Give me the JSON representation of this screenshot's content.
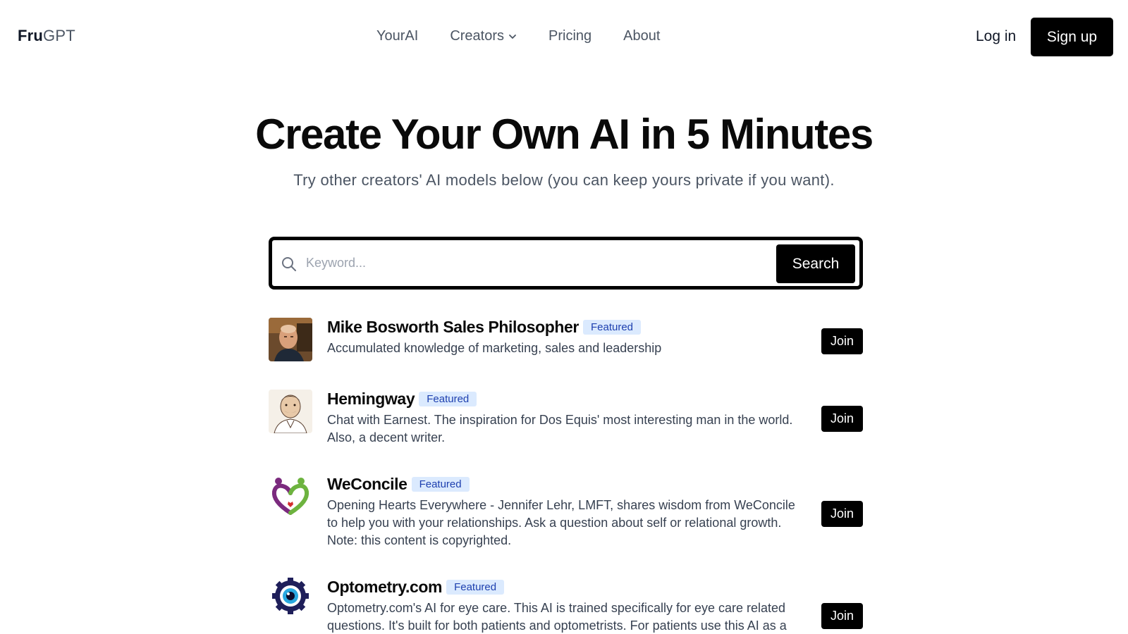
{
  "header": {
    "logo_bold": "Fru",
    "logo_rest": "GPT",
    "nav": [
      {
        "label": "YourAI"
      },
      {
        "label": "Creators"
      },
      {
        "label": "Pricing"
      },
      {
        "label": "About"
      }
    ],
    "login": "Log in",
    "signup": "Sign up"
  },
  "hero": {
    "title": "Create Your Own AI in 5 Minutes",
    "subtitle": "Try other creators' AI models below (you can keep yours private if you want)."
  },
  "search": {
    "placeholder": "Keyword...",
    "button": "Search"
  },
  "listings": [
    {
      "name": "Mike Bosworth Sales Philosopher",
      "badge": "Featured",
      "description": "Accumulated knowledge of marketing, sales and leadership",
      "join": "Join",
      "icon": "portrait-photo-icon"
    },
    {
      "name": "Hemingway",
      "badge": "Featured",
      "description": "Chat with Earnest. The inspiration for Dos Equis' most interesting man in the world. Also, a decent writer.",
      "join": "Join",
      "icon": "portrait-sketch-icon"
    },
    {
      "name": "WeConcile",
      "badge": "Featured",
      "description": "Opening Hearts Everywhere - Jennifer Lehr, LMFT, shares wisdom from WeConcile to help you with your relationships. Ask a question about self or relational growth. Note: this content is copyrighted.",
      "join": "Join",
      "icon": "heart-logo-icon"
    },
    {
      "name": "Optometry.com",
      "badge": "Featured",
      "description": "Optometry.com's AI for eye care. This AI is trained specifically for eye care related questions. It's built for both patients and optometrists. For patients use this AI as a",
      "join": "Join",
      "icon": "eye-gear-logo-icon"
    }
  ]
}
